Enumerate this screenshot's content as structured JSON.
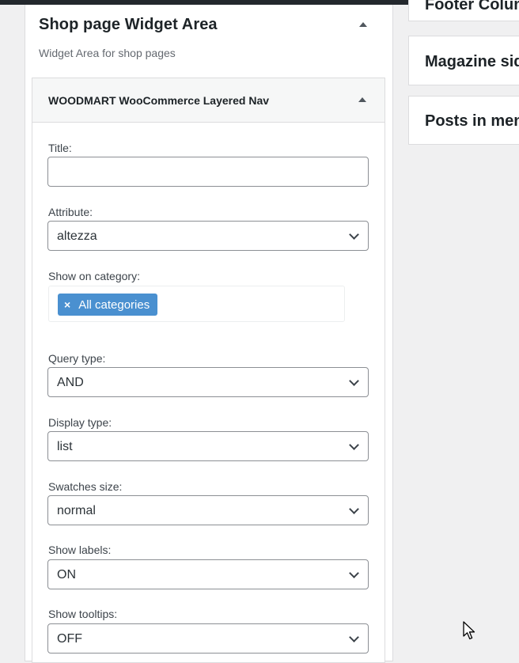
{
  "sidebar": {
    "title": "Shop page Widget Area",
    "description": "Widget Area for shop pages"
  },
  "widget": {
    "title": "WOODMART WooCommerce Layered Nav",
    "title_label": "Title:",
    "title_value": "",
    "attribute_label": "Attribute:",
    "attribute_value": "altezza",
    "show_on_category_label": "Show on category:",
    "category_chip_remove": "×",
    "category_chip": "All categories",
    "query_type_label": "Query type:",
    "query_type_value": "AND",
    "display_type_label": "Display type:",
    "display_type_value": "list",
    "swatches_size_label": "Swatches size:",
    "swatches_size_value": "normal",
    "show_labels_label": "Show labels:",
    "show_labels_value": "ON",
    "show_tooltips_label": "Show tooltips:",
    "show_tooltips_value": "OFF"
  },
  "right_panels": {
    "footer_column": "Footer Column",
    "magazine_sidebar": "Magazine sidebar",
    "posts_in_menu": "Posts in menu"
  },
  "icons": {
    "collapse": "caret-up-icon",
    "dropdown": "chevron-down-icon",
    "cursor": "mouse-pointer-icon"
  }
}
